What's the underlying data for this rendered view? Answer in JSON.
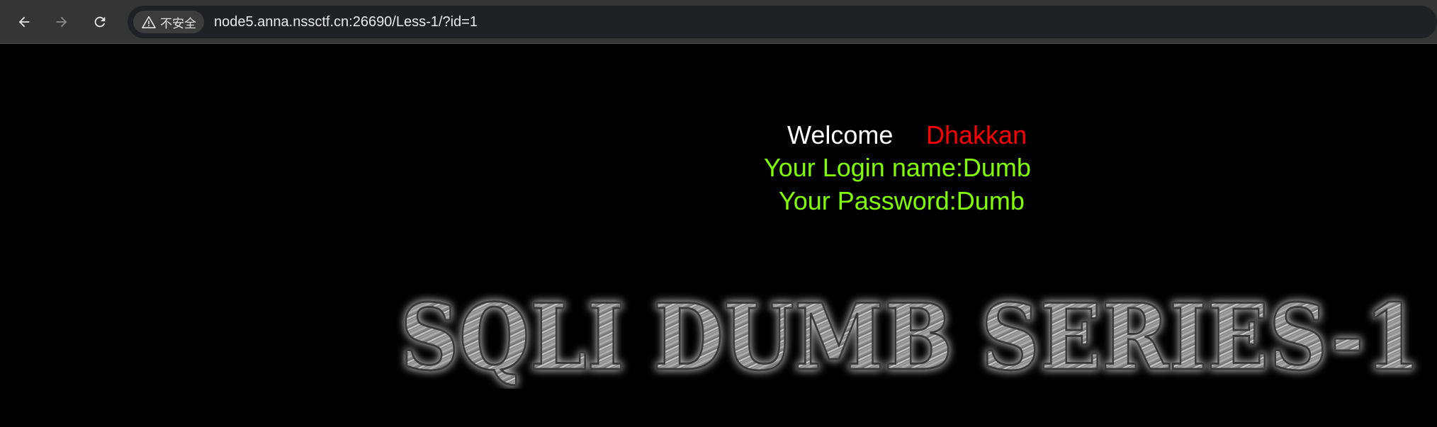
{
  "browser": {
    "security_label": "不安全",
    "url": "node5.anna.nssctf.cn:26690/Less-1/?id=1"
  },
  "page": {
    "welcome_text": "Welcome",
    "welcome_user": "Dhakkan",
    "login_line": "Your Login name:Dumb",
    "password_line": "Your Password:Dumb",
    "banner_text": "SQLI DUMB SERIES-1"
  },
  "colors": {
    "welcome": "#ffffff",
    "username": "#ff0000",
    "info": "#7fff00",
    "background": "#000000"
  }
}
